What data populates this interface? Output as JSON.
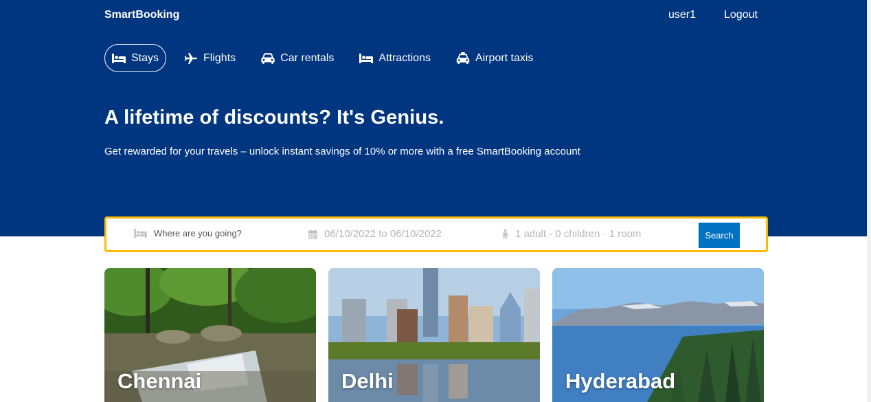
{
  "header": {
    "brand": "SmartBooking",
    "username": "user1",
    "logout_label": "Logout"
  },
  "nav": {
    "items": [
      {
        "label": "Stays",
        "icon": "bed-icon",
        "active": true
      },
      {
        "label": "Flights",
        "icon": "plane-icon",
        "active": false
      },
      {
        "label": "Car rentals",
        "icon": "car-icon",
        "active": false
      },
      {
        "label": "Attractions",
        "icon": "bed-icon",
        "active": false
      },
      {
        "label": "Airport taxis",
        "icon": "taxi-icon",
        "active": false
      }
    ]
  },
  "hero": {
    "headline": "A lifetime of discounts? It's Genius.",
    "subline": "Get rewarded for your travels – unlock instant savings of 10% or more with a free SmartBooking account"
  },
  "search": {
    "destination_placeholder": "Where are you going?",
    "dates": "06/10/2022 to 06/10/2022",
    "guests": "1 adult · 0 children · 1 room",
    "button_label": "Search"
  },
  "cities": [
    {
      "name": "Chennai",
      "subtitle": ""
    },
    {
      "name": "Delhi",
      "subtitle": ""
    },
    {
      "name": "Hyderabad",
      "subtitle": ""
    }
  ],
  "colors": {
    "brand_blue": "#003580",
    "search_border": "#febb02",
    "search_button": "#0071c2"
  }
}
